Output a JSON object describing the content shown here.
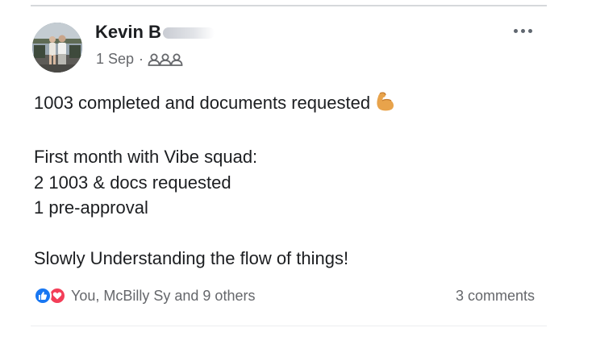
{
  "post": {
    "author": {
      "name_visible": "Kevin B"
    },
    "timestamp": "1 Sep",
    "separator": "·",
    "audience_icon": "group-icon",
    "more_icon": "more-horizontal-icon",
    "body": {
      "line1": "1003 completed and documents requested",
      "line1_emoji": "flexed-biceps-icon",
      "line2": "First month with Vibe squad:",
      "line3": "2 1003 & docs requested",
      "line4": "1 pre-approval",
      "line5": "Slowly Understanding the flow of things!"
    },
    "reactions": {
      "icons": [
        "like-icon",
        "love-icon"
      ],
      "summary": "You, McBilly Sy and 9 others"
    },
    "comments_label": "3 comments"
  },
  "colors": {
    "text_primary": "#1c1e21",
    "text_secondary": "#65676b",
    "like_blue": "#1877f2",
    "love_red": "#f33e58",
    "divider": "#d6d8db"
  }
}
